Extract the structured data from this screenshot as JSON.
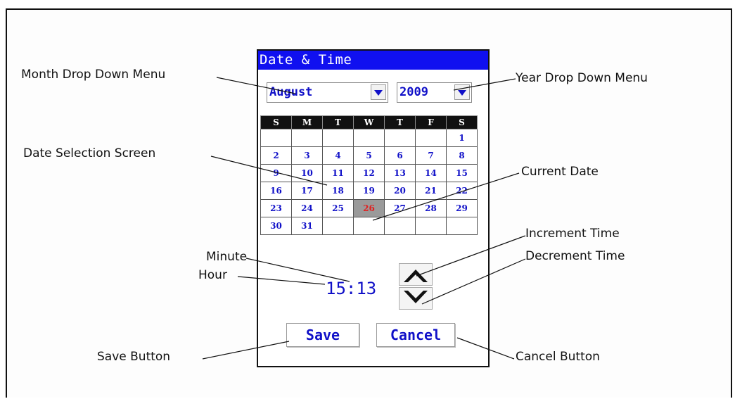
{
  "window": {
    "title": "Date & Time"
  },
  "month_dropdown": {
    "selected": "August"
  },
  "year_dropdown": {
    "selected": "2009"
  },
  "calendar": {
    "weekdays": [
      "S",
      "M",
      "T",
      "W",
      "T",
      "F",
      "S"
    ],
    "weeks": [
      [
        "",
        "",
        "",
        "",
        "",
        "",
        "1"
      ],
      [
        "2",
        "3",
        "4",
        "5",
        "6",
        "7",
        "8"
      ],
      [
        "9",
        "10",
        "11",
        "12",
        "13",
        "14",
        "15"
      ],
      [
        "16",
        "17",
        "18",
        "19",
        "20",
        "21",
        "22"
      ],
      [
        "23",
        "24",
        "25",
        "26",
        "27",
        "28",
        "29"
      ],
      [
        "30",
        "31",
        "",
        "",
        "",
        "",
        ""
      ]
    ],
    "current_date": "26"
  },
  "time": {
    "hour": "15",
    "separator": ":",
    "minute": "13"
  },
  "buttons": {
    "save": "Save",
    "cancel": "Cancel"
  },
  "annotations": {
    "month_menu": "Month Drop Down Menu",
    "year_menu": "Year Drop Down Menu",
    "date_selection": "Date Selection Screen",
    "current_date": "Current Date",
    "increment": "Increment Time",
    "decrement": "Decrement Time",
    "minute": "Minute",
    "hour": "Hour",
    "save_button": "Save Button",
    "cancel_button": "Cancel Button"
  },
  "colors": {
    "title_bar": "#1010f0",
    "text_blue": "#1010c8",
    "current_date_text": "#e02020",
    "current_date_bg": "#9a9a9a"
  }
}
